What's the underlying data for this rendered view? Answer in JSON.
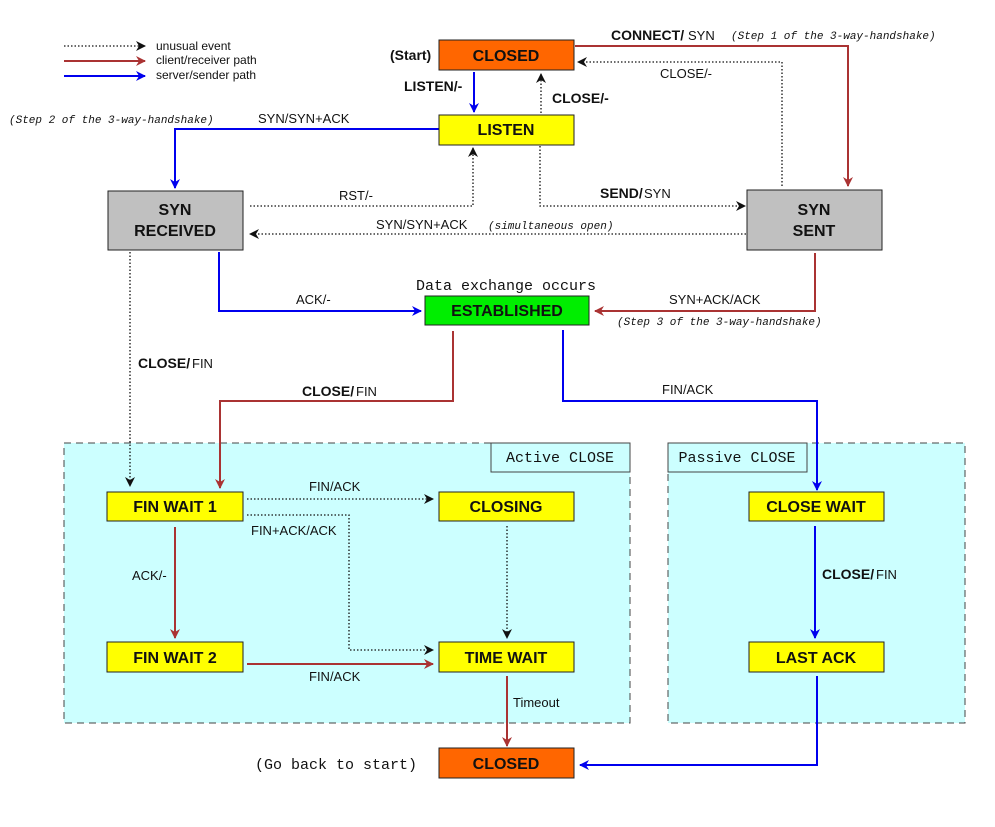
{
  "colors": {
    "closed_fill": "#ff6600",
    "wait_fill": "#ffff00",
    "syn_fill": "#c0c0c0",
    "established_fill": "#00ee00",
    "group_fill": "#ccffff",
    "client_path": "#aa3333",
    "server_path": "#0000ee",
    "unusual": "#111111"
  },
  "legend": {
    "unusual": "unusual event",
    "client": "client/receiver path",
    "server": "server/sender path"
  },
  "states": {
    "closed_top": "CLOSED",
    "listen": "LISTEN",
    "syn_received_1": "SYN",
    "syn_received_2": "RECEIVED",
    "syn_sent_1": "SYN",
    "syn_sent_2": "SENT",
    "established": "ESTABLISHED",
    "fin_wait_1": "FIN WAIT 1",
    "fin_wait_2": "FIN WAIT 2",
    "closing": "CLOSING",
    "time_wait": "TIME WAIT",
    "close_wait": "CLOSE WAIT",
    "last_ack": "LAST ACK",
    "closed_bottom": "CLOSED"
  },
  "groups": {
    "active": "Active CLOSE",
    "passive": "Passive CLOSE"
  },
  "notes": {
    "start": "(Start)",
    "step1": "(Step 1 of the 3-way-handshake)",
    "step2": "(Step 2 of the 3-way-handshake)",
    "step3": "(Step 3 of the 3-way-handshake)",
    "simultaneous": "(simultaneous open)",
    "data_exchange": "Data exchange occurs",
    "go_back": "(Go back to start)"
  },
  "transitions": {
    "connect_event": "CONNECT/",
    "connect_action": "SYN",
    "listen": "LISTEN/-",
    "close_listen": "CLOSE/-",
    "close_synsent": "CLOSE/-",
    "syn_synack": "SYN/SYN+ACK",
    "rst": "RST/-",
    "send_event": "SEND/",
    "send_action": "SYN",
    "simul_synack": "SYN/SYN+ACK",
    "ack_est": "ACK/-",
    "synack_ack": "SYN+ACK/ACK",
    "close_fin_synrcvd_event": "CLOSE/",
    "close_fin_synrcvd_action": "FIN",
    "close_fin_est_event": "CLOSE/",
    "close_fin_est_action": "FIN",
    "fin_ack_passive": "FIN/ACK",
    "fin_ack_closing": "FIN/ACK",
    "finack_ack": "FIN+ACK/ACK",
    "ack_finwait2": "ACK/-",
    "fin_ack_timewait": "FIN/ACK",
    "timeout": "Timeout",
    "close_fin_passive_event": "CLOSE/",
    "close_fin_passive_action": "FIN"
  }
}
